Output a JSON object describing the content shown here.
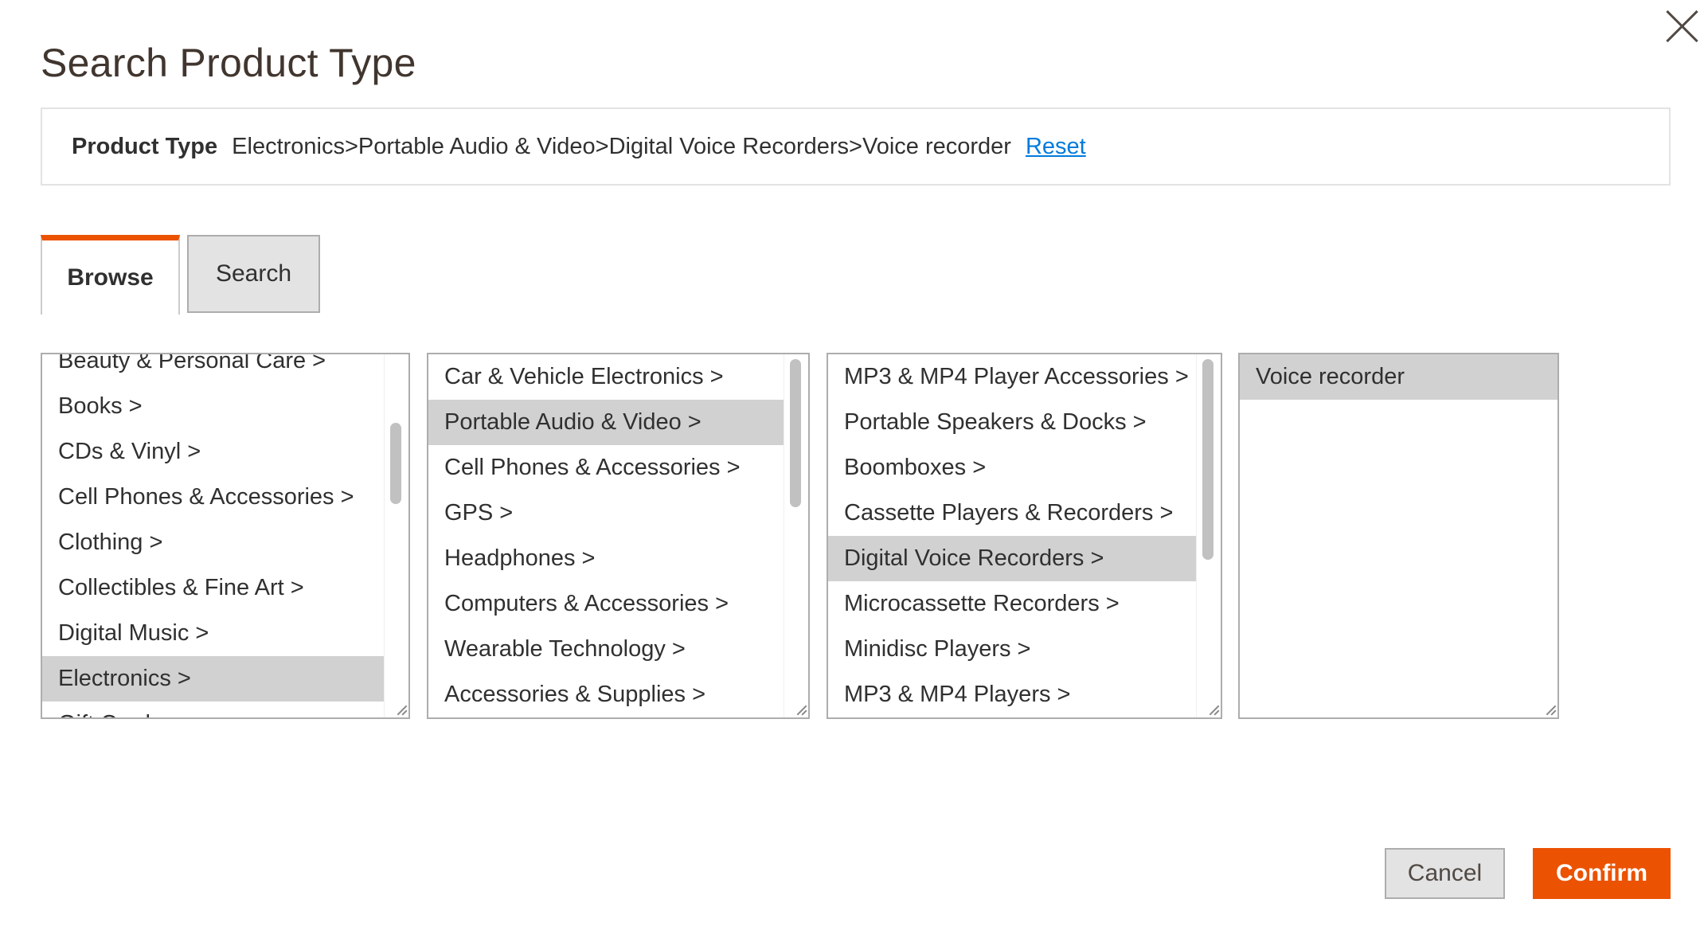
{
  "modal": {
    "title": "Search Product Type",
    "close_icon": "close-icon"
  },
  "product_type": {
    "label": "Product Type",
    "value": "Electronics>Portable Audio & Video>Digital Voice Recorders>Voice recorder",
    "reset_label": "Reset"
  },
  "tabs": [
    {
      "label": "Browse",
      "active": true
    },
    {
      "label": "Search",
      "active": false
    }
  ],
  "columns": [
    {
      "items": [
        "Beauty & Personal Care >",
        "Books >",
        "CDs & Vinyl >",
        "Cell Phones & Accessories >",
        "Clothing >",
        "Collectibles & Fine Art >",
        "Digital Music >",
        "Electronics >",
        "Gift Cards >"
      ],
      "selected": "Electronics >"
    },
    {
      "items": [
        "Car & Vehicle Electronics >",
        "Portable Audio & Video >",
        "Cell Phones & Accessories >",
        "GPS >",
        "Headphones >",
        "Computers & Accessories >",
        "Wearable Technology >",
        "Accessories & Supplies >"
      ],
      "selected": "Portable Audio & Video >"
    },
    {
      "items": [
        "MP3 & MP4 Player Accessories >",
        "Portable Speakers & Docks >",
        "Boomboxes >",
        "Cassette Players & Recorders >",
        "Digital Voice Recorders >",
        "Microcassette Recorders >",
        "Minidisc Players >",
        "MP3 & MP4 Players >"
      ],
      "selected": "Digital Voice Recorders >"
    },
    {
      "items": [
        "Voice recorder"
      ],
      "selected": "Voice recorder"
    }
  ],
  "footer": {
    "cancel_label": "Cancel",
    "confirm_label": "Confirm"
  },
  "colors": {
    "accent": "#eb5202",
    "link": "#007bdb",
    "selected_row": "#d1d1d1"
  }
}
